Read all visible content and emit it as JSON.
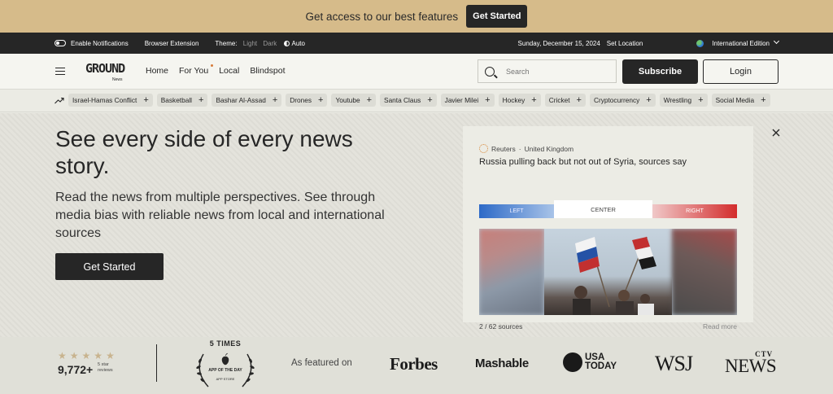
{
  "promo": {
    "text": "Get access to our best features",
    "button": "Get Started"
  },
  "topbar": {
    "notifications": "Enable Notifications",
    "extension": "Browser Extension",
    "theme_label": "Theme:",
    "theme_options": [
      "Light",
      "Dark",
      "Auto"
    ],
    "date": "Sunday, December 15, 2024",
    "set_location": "Set Location",
    "edition": "International Edition"
  },
  "header": {
    "logo_text": "GROUND",
    "logo_sub": "News",
    "nav": [
      "Home",
      "For You",
      "Local",
      "Blindspot"
    ],
    "search_placeholder": "Search",
    "subscribe": "Subscribe",
    "login": "Login"
  },
  "topics": [
    "Israel-Hamas Conflict",
    "Basketball",
    "Bashar Al-Assad",
    "Drones",
    "Youtube",
    "Santa Claus",
    "Javier Milei",
    "Hockey",
    "Cricket",
    "Cryptocurrency",
    "Wrestling",
    "Social Media"
  ],
  "hero": {
    "title": "See every side of every news story.",
    "description": "Read the news from multiple perspectives. See through media bias with reliable news from local and international sources",
    "button": "Get Started"
  },
  "story": {
    "source": "Reuters",
    "location": "United Kingdom",
    "headline": "Russia pulling back but not out of Syria, sources say",
    "bias": {
      "left": "LEFT",
      "center": "CENTER",
      "right": "RIGHT"
    },
    "sources_count": "2 / 62 sources",
    "read_more": "Read more"
  },
  "social_proof": {
    "stars": 5,
    "rating": "9,772+",
    "rating_sub": "5 star reviews",
    "award_times": "5 TIMES",
    "award_line1": "APP OF THE DAY",
    "award_line2": "APP STORE",
    "featured_label": "As featured on",
    "publications": {
      "forbes": "Forbes",
      "mashable": "Mashable",
      "usa_today_1": "USA",
      "usa_today_2": "TODAY",
      "wsj": "WSJ",
      "ctv_top": "CTV",
      "ctv_bottom": "NEWS"
    }
  },
  "colors": {
    "promo_bg": "#d6bb8a",
    "dark": "#262626",
    "left_blue": "#2d6ac7",
    "right_red": "#d32c2c",
    "star": "#c8b38e"
  }
}
